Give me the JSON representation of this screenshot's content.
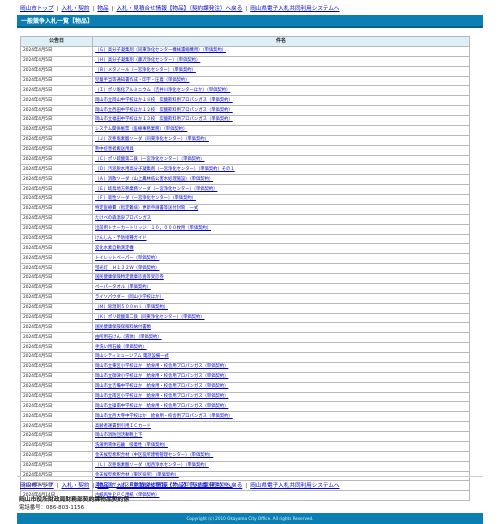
{
  "nav": {
    "items": [
      "岡山市トップ",
      "入札・契約",
      "物品",
      "入札・見積合せ情報【物品】（契約課発注）へ戻る",
      "岡山県電子入札共同利用システムへ"
    ],
    "separator": "|"
  },
  "title": "一般競争入札一覧【物品】",
  "table": {
    "headers": [
      "公告日",
      "件名"
    ],
    "rows": [
      {
        "date": "2024年4月5日",
        "item": "（Ｇ）高分子凝集剤（同東浄化センター機械濃縮機用）（単価契約）"
      },
      {
        "date": "2024年4月5日",
        "item": "（Ｈ）高分子凝集剤（藤沢浄化センター）（単価契約）"
      },
      {
        "date": "2024年4月5日",
        "item": "（Ｂ）メタノール（一宮浄化センター）（単価契約）"
      },
      {
        "date": "2024年4月5日",
        "item": "児童手当等通知書作成・印字・圧着（単価契約）"
      },
      {
        "date": "2024年4月5日",
        "item": "（Ｉ）ポリ塩化アルミニウム（吉井川浄化センターほか）（単価契約）"
      },
      {
        "date": "2024年4月5日",
        "item": "岡山市立岡山中学校ほか１８校　炭酸飲料用プロパンガス（単価契約）"
      },
      {
        "date": "2024年4月5日",
        "item": "岡山市立西田中学校ほか１２校　炭酸飲料用プロパンガス（単価契約）"
      },
      {
        "date": "2024年4月5日",
        "item": "岡山市立福田中学校ほか１３校　炭酸飲料用プロパンガス（単価契約）"
      },
      {
        "date": "2024年4月5日",
        "item": "システム関係帳票（医療事務業務）（単価契約）"
      },
      {
        "date": "2024年4月5日",
        "item": "（Ｊ）次亜塩素酸ソーダ（同東浄化センター）（単価契約）"
      },
      {
        "date": "2024年4月5日",
        "item": "熟中症患者搬送用具"
      },
      {
        "date": "2024年4月5日",
        "item": "（Ｃ）ポリ硫酸第二鉄（一宮浄化センター）（単価契約）"
      },
      {
        "date": "2024年4月5日",
        "item": "（Ｄ）汚泥脱水用高分子凝集剤（一宮浄化センター）（単価契約）その１"
      },
      {
        "date": "2024年4月5日",
        "item": "（Ａ）消散ソーダ（山上農林低公害水処理施設）（単価契約）"
      },
      {
        "date": "2024年4月5日",
        "item": "（Ｅ）岐鳥地方熱業務ソーダ（一宮浄化センター）（単価契約）"
      },
      {
        "date": "2024年4月5日",
        "item": "（Ｆ）吸性ソーダ（一宮浄化センター）（単価契約）"
      },
      {
        "date": "2024年4月5日",
        "item": "特定医療費（指定難病）更新申請書等送付封筒　一式"
      },
      {
        "date": "2024年4月5日",
        "item": "たけべの森温泉プロパンガス"
      },
      {
        "date": "2024年4月5日",
        "item": "出前用トナーカートリッジ　１０，０００枚用（単価契約）"
      },
      {
        "date": "2024年4月5日",
        "item": "けんしん・予防接種ガイド"
      },
      {
        "date": "2024年4月5日",
        "item": "炭化水素自動測定機"
      },
      {
        "date": "2024年4月5日",
        "item": "トイレットペーパー（単価契約）"
      },
      {
        "date": "2024年4月5日",
        "item": "蛍光灯　Ｈ１３２Ｗ（単価契約）"
      },
      {
        "date": "2024年4月5日",
        "item": "国民健康保険特定健康診査等受診券"
      },
      {
        "date": "2024年4月5日",
        "item": "ペーパータオル（単価契約）"
      },
      {
        "date": "2024年4月5日",
        "item": "ライソパウダー（岡山小学校ほか）"
      },
      {
        "date": "2024年4月5日",
        "item": "（Ｍ）除湿剤５００ｍｌ（単価契約）"
      },
      {
        "date": "2024年4月5日",
        "item": "（Ｋ）ポリ硫酸第二鉄（同東浄化センター）（単価契約）"
      },
      {
        "date": "2024年4月5日",
        "item": "国民健康保険保険料納付書類"
      },
      {
        "date": "2024年4月5日",
        "item": "由所用石けん（液体）（単価契約）"
      },
      {
        "date": "2024年4月5日",
        "item": "手洗い用石鹸（単価契約）"
      },
      {
        "date": "2024年4月5日",
        "item": "岡山シティミュージアム 電話設備一式"
      },
      {
        "date": "2024年4月5日",
        "item": "岡山市立東区小学校ほか　給食用・校舎用プロパンガス（単価契約）"
      },
      {
        "date": "2024年4月5日",
        "item": "岡山市立御津小学校ほか　給食用・校舎用プロパンガス（単価契約）"
      },
      {
        "date": "2024年4月5日",
        "item": "岡山市立吉備中学校ほか　給食用・校舎用プロパンガス（単価契約）"
      },
      {
        "date": "2024年4月5日",
        "item": "岡山市立南区小学校ほか　給食用・校舎用プロパンガス（単価契約）"
      },
      {
        "date": "2024年4月5日",
        "item": "岡山市立操南中学校ほか　給食用・校舎用プロパンガス（単価契約）"
      },
      {
        "date": "2024年4月5日",
        "item": "岡山市立西大寺中学校ほか　給食用・校舎用プロパンガス（単価契約）"
      },
      {
        "date": "2024年4月5日",
        "item": "高齢者運賃割引用ＩＣカード"
      },
      {
        "date": "2024年4月5日",
        "item": "岡山市消防団活動靴上下"
      },
      {
        "date": "2024年4月5日",
        "item": "洗濯用液体石鹸　吸着性（単価契約）"
      },
      {
        "date": "2024年4月5日",
        "item": "金天候型希釈合材（中区役所建物管理センター）（単価契約）"
      },
      {
        "date": "2024年4月5日",
        "item": "（Ｌ）次亜塩素酸ソーダ（旭西浄水センター）（単価契約）"
      },
      {
        "date": "2024年4月5日",
        "item": "金天候型希釈合材（東区役所）（単価契約）"
      },
      {
        "date": "2024年4月5日",
        "item": "美容介護サービス費水位送達処理作成・データ印字・圧着（単価契約）"
      },
      {
        "date": "2024年4月14日",
        "item": "古紙再生ＰＰＣ用紙（単価契約）"
      }
    ]
  },
  "footer": {
    "org": "岡山市役所財政局財務部契約課物品契約係",
    "tel": "電話番号：086-803-1156",
    "copyright": "Copyright (c) 2010 Okayama City Office. All rights Reserved."
  }
}
